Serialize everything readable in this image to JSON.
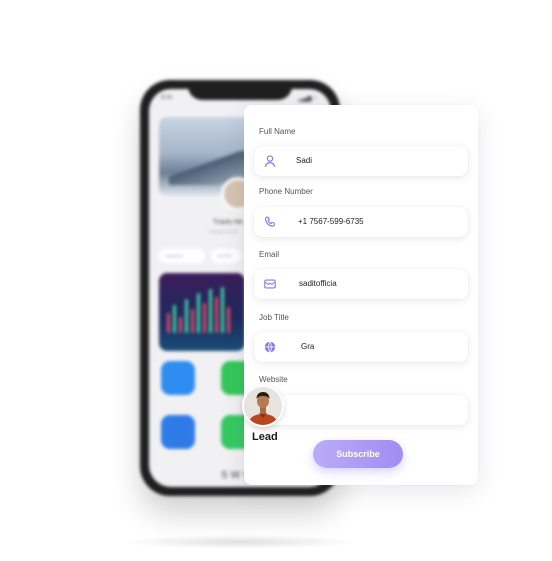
{
  "phone": {
    "status_time": "9:41",
    "status_icons": "▂▄▆ ◔",
    "profile_name": "Travis He...",
    "profile_subtitle": "Founder & CEO",
    "chips": [
      "Instagram",
      "LinkedIn"
    ],
    "bottom_text": "SWI"
  },
  "form": {
    "fields": [
      {
        "label": "Full Name",
        "value": "Sadi",
        "icon": "user-icon"
      },
      {
        "label": "Phone Number",
        "value": "+1 7567-599-6735",
        "icon": "phone-icon"
      },
      {
        "label": "Email",
        "value": "saditofficia",
        "icon": "mail-icon"
      },
      {
        "label": "Job Title",
        "value": "Gra",
        "icon": "globe-icon"
      },
      {
        "label": "Website",
        "value": "",
        "icon": ""
      }
    ],
    "subscribe_label": "Subscribe",
    "accent_color": "#a694f4"
  },
  "lead": {
    "label": "Lead"
  }
}
